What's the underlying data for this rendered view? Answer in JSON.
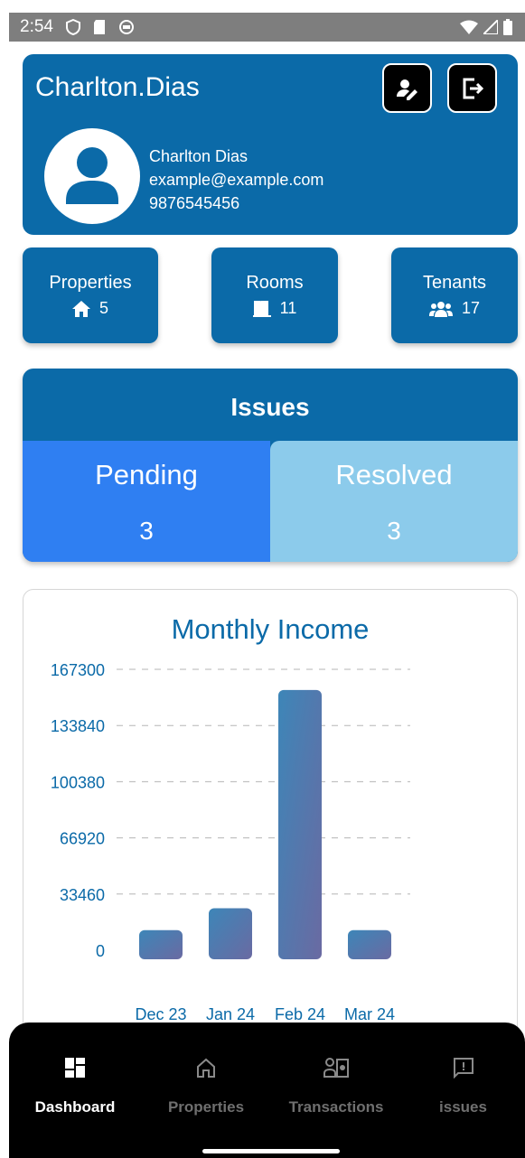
{
  "status_bar": {
    "time": "2:54"
  },
  "profile": {
    "username": "Charlton.Dias",
    "full_name": "Charlton Dias",
    "email": "example@example.com",
    "phone": "9876545456",
    "edit_icon": "edit-user-icon",
    "logout_icon": "logout-icon"
  },
  "stats": [
    {
      "label": "Properties",
      "icon": "house-icon",
      "value": "5"
    },
    {
      "label": "Rooms",
      "icon": "door-icon",
      "value": "11"
    },
    {
      "label": "Tenants",
      "icon": "users-icon",
      "value": "17"
    }
  ],
  "issues": {
    "title": "Issues",
    "pending_label": "Pending",
    "pending_count": "3",
    "resolved_label": "Resolved",
    "resolved_count": "3"
  },
  "chart_data": {
    "type": "bar",
    "title": "Monthly Income",
    "categories": [
      "Dec 23",
      "Jan 24",
      "Feb 24",
      "Mar 24"
    ],
    "values": [
      12000,
      25000,
      155000,
      12000
    ],
    "ylim": [
      0,
      167300
    ],
    "yticks": [
      "0",
      "33460",
      "66920",
      "100380",
      "133840",
      "167300"
    ],
    "grid": true,
    "bar_gradient": [
      "#3d86b8",
      "#6a6aa2"
    ],
    "axis_color": "#0b6aa8"
  },
  "nav": [
    {
      "label": "Dashboard",
      "icon": "dashboard-icon",
      "active": true
    },
    {
      "label": "Properties",
      "icon": "home-outline-icon",
      "active": false
    },
    {
      "label": "Transactions",
      "icon": "transactions-icon",
      "active": false
    },
    {
      "label": "issues",
      "icon": "issue-report-icon",
      "active": false
    }
  ],
  "colors": {
    "primary": "#0b6aa8",
    "pending": "#2f7ff2",
    "resolved": "#8ccbeb",
    "nav_bg": "#000000"
  }
}
